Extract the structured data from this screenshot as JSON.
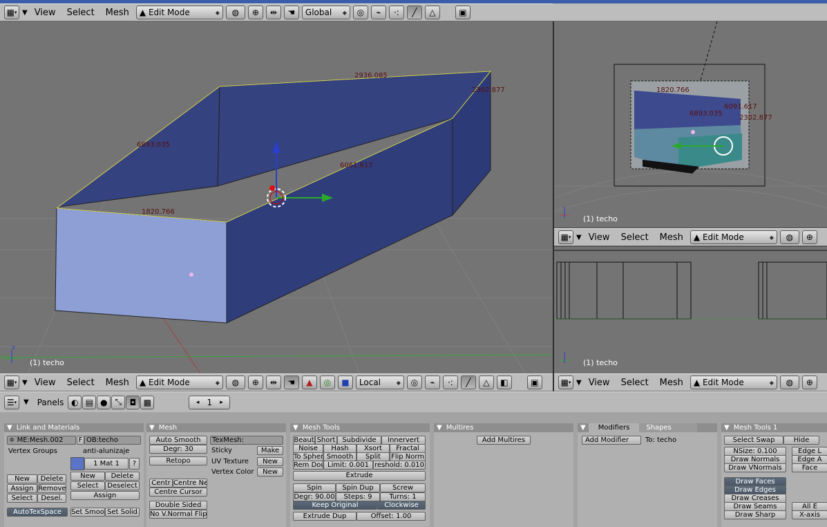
{
  "top_header": {
    "menus": [
      "View",
      "Select",
      "Mesh"
    ],
    "mode": "Edit Mode",
    "orientation": "Global"
  },
  "main_view": {
    "object_label": "(1) techo",
    "edge_lengths": [
      "2936.085",
      "2302.877",
      "6893.035",
      "6061.617",
      "1820.766"
    ],
    "axis_z": "z",
    "axis_y": "y"
  },
  "camera_view": {
    "object_label": "(1) techo",
    "edge_lengths": [
      "1820.766",
      "6091.617",
      "6893.035",
      "2302.877"
    ],
    "menus": [
      "View",
      "Select",
      "Mesh"
    ],
    "mode": "Edit Mode"
  },
  "side_view": {
    "object_label": "(1) techo"
  },
  "bottom_header": {
    "menus": [
      "View",
      "Select",
      "Mesh"
    ],
    "mode": "Edit Mode",
    "orientation": "Local"
  },
  "side_header": {
    "menus": [
      "View",
      "Select",
      "Mesh"
    ],
    "mode": "Edit Mode"
  },
  "buttons_window": {
    "panels_label": "Panels",
    "frame": "1"
  },
  "link_materials": {
    "title": "Link and Materials",
    "mesh_name": "ME:Mesh.002",
    "f_label": "F",
    "object_name": "OB:techo",
    "vertex_groups": "Vertex Groups",
    "material_name": "anti-alunizaje",
    "mat_index": "1 Mat 1",
    "question": "?",
    "vg_buttons": [
      "New",
      "Delete",
      "Assign",
      "Remove",
      "Select",
      "Desel."
    ],
    "mat_buttons": [
      "New",
      "Delete",
      "Select",
      "Deselect",
      "Assign"
    ],
    "autotex": "AutoTexSpace",
    "set_smooth": "Set Smoo",
    "set_solid": "Set Solid"
  },
  "mesh_panel": {
    "title": "Mesh",
    "auto_smooth": "Auto Smooth",
    "degr": "Degr: 30",
    "retopo": "Retopo",
    "centre": "Centr",
    "centre_new": "Centre Ne",
    "centre_cursor": "Centre Cursor",
    "double_sided": "Double Sided",
    "no_vnormal": "No V.Normal Flip",
    "texmesh": "TexMesh:",
    "sticky": "Sticky",
    "make": "Make",
    "uv_texture": "UV Texture",
    "uv_new": "New",
    "vertex_color": "Vertex Color",
    "vc_new": "New"
  },
  "mesh_tools": {
    "title": "Mesh Tools",
    "row1": [
      "Beaut",
      "Short",
      "Subdivide",
      "Innervert"
    ],
    "row2": [
      "Noise",
      "Hash",
      "Xsort",
      "Fractal"
    ],
    "row3": [
      "To Spher",
      "Smooth",
      "Split",
      "Flip Norm"
    ],
    "rem_dou": "Rem Dou",
    "limit": "Limit: 0.001",
    "threshold": "reshold: 0.010",
    "extrude": "Extrude",
    "spin": "Spin",
    "spin_dup": "Spin Dup",
    "screw": "Screw",
    "degr": "Degr: 90.00",
    "steps": "Steps: 9",
    "turns": "Turns: 1",
    "keep_original": "Keep Original",
    "clockwise": "Clockwise",
    "extrude_dup": "Extrude Dup",
    "offset": "Offset: 1.00"
  },
  "multires": {
    "title": "Multires",
    "add": "Add Multires"
  },
  "modifiers": {
    "tab_modifiers": "Modifiers",
    "tab_shapes": "Shapes",
    "add": "Add Modifier",
    "to": "To: techo"
  },
  "mesh_tools1": {
    "title": "Mesh Tools 1",
    "select_swap": "Select Swap",
    "hide": "Hide",
    "nsize": "NSize: 0.100",
    "draw_normals": "Draw Normals",
    "draw_vnormals": "Draw VNormals",
    "draw_faces": "Draw Faces",
    "draw_edges": "Draw Edges",
    "draw_creases": "Draw Creases",
    "draw_seams": "Draw Seams",
    "draw_sharp": "Draw Sharp",
    "edge1": "Edge L",
    "edge2": "Edge A",
    "face": "Face",
    "all_edges": "All E",
    "x_axis": "X-axis"
  },
  "colors": {
    "viewport_bg": "#747474",
    "mesh_light": "#8ea0d8",
    "mesh_dark": "#2c3a78",
    "selected_edge": "#d8d85a",
    "header_bg": "#bdbdbd"
  }
}
